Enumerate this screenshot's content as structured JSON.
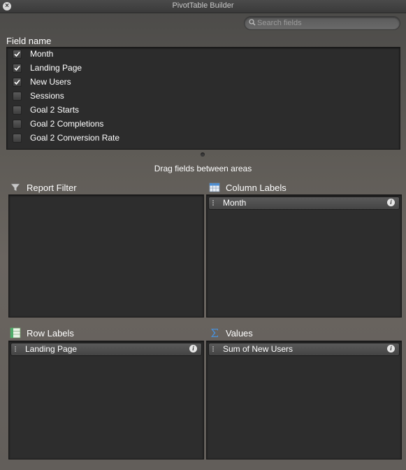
{
  "window": {
    "title": "PivotTable Builder"
  },
  "search": {
    "placeholder": "Search fields",
    "value": ""
  },
  "field_list": {
    "header": "Field name",
    "fields": [
      {
        "label": "Month",
        "checked": true
      },
      {
        "label": "Landing Page",
        "checked": true
      },
      {
        "label": "New Users",
        "checked": true
      },
      {
        "label": "Sessions",
        "checked": false
      },
      {
        "label": "Goal 2 Starts",
        "checked": false
      },
      {
        "label": "Goal 2 Completions",
        "checked": false
      },
      {
        "label": "Goal 2 Conversion Rate",
        "checked": false
      }
    ]
  },
  "drag_hint": "Drag fields between areas",
  "areas": {
    "report_filter": {
      "label": "Report Filter",
      "icon": "filter-icon",
      "items": []
    },
    "column_labels": {
      "label": "Column Labels",
      "icon": "column-labels-icon",
      "items": [
        "Month"
      ]
    },
    "row_labels": {
      "label": "Row Labels",
      "icon": "row-labels-icon",
      "items": [
        "Landing Page"
      ]
    },
    "values": {
      "label": "Values",
      "icon": "sigma-icon",
      "items": [
        "Sum of New Users"
      ]
    }
  },
  "colors": {
    "panel": "#2d2d2d",
    "chip": "#4d4d4d",
    "accent_blue": "#4a8fd6"
  }
}
